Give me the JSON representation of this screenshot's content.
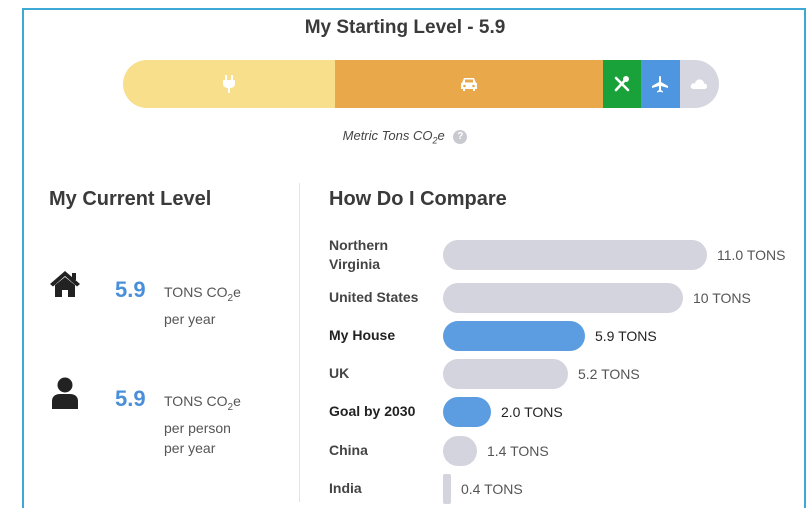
{
  "title": "My Starting Level - 5.9",
  "emissions_bar": {
    "max_value": 5.9,
    "segments": [
      {
        "name": "home-energy",
        "icon": "plug-icon",
        "color": "#f8df8c",
        "value": 2.1
      },
      {
        "name": "car",
        "icon": "car-icon",
        "color": "#e9a94a",
        "value": 2.65
      },
      {
        "name": "food",
        "icon": "utensils-icon",
        "color": "#19a13a",
        "value": 0.38
      },
      {
        "name": "air-travel",
        "icon": "airplane-icon",
        "color": "#4f96e0",
        "value": 0.38
      },
      {
        "name": "other",
        "icon": "cloud-icon",
        "color": "#d5d6df",
        "value": 0.39
      }
    ]
  },
  "units_note": {
    "prefix": "Metric Tons CO",
    "sub": "2",
    "suffix": "e",
    "help": "?"
  },
  "current_level": {
    "heading": "My Current Level",
    "house": {
      "value": "5.9",
      "unit_prefix": "TONS CO",
      "unit_sub": "2",
      "unit_suffix": "e",
      "line2": "per year",
      "icon": "house-icon"
    },
    "person": {
      "value": "5.9",
      "unit_prefix": "TONS CO",
      "unit_sub": "2",
      "unit_suffix": "e",
      "line2": "per person",
      "line3": "per year",
      "icon": "person-icon"
    }
  },
  "compare": {
    "heading": "How Do I Compare",
    "max_value": 11.0,
    "rows": [
      {
        "label_line1": "Northern",
        "label_line2": "Virginia",
        "value": 11.0,
        "value_label": "11.0 TONS",
        "highlight": false
      },
      {
        "label_line1": "United States",
        "label_line2": "",
        "value": 10.0,
        "value_label": "10 TONS",
        "highlight": false
      },
      {
        "label_line1": "My House",
        "label_line2": "",
        "value": 5.9,
        "value_label": "5.9 TONS",
        "highlight": true
      },
      {
        "label_line1": "UK",
        "label_line2": "",
        "value": 5.2,
        "value_label": "5.2 TONS",
        "highlight": false
      },
      {
        "label_line1": "Goal by 2030",
        "label_line2": "",
        "value": 2.0,
        "value_label": "2.0 TONS",
        "highlight": true
      },
      {
        "label_line1": "China",
        "label_line2": "",
        "value": 1.4,
        "value_label": "1.4 TONS",
        "highlight": false
      },
      {
        "label_line1": "India",
        "label_line2": "",
        "value": 0.4,
        "value_label": "0.4 TONS",
        "highlight": false
      }
    ]
  }
}
